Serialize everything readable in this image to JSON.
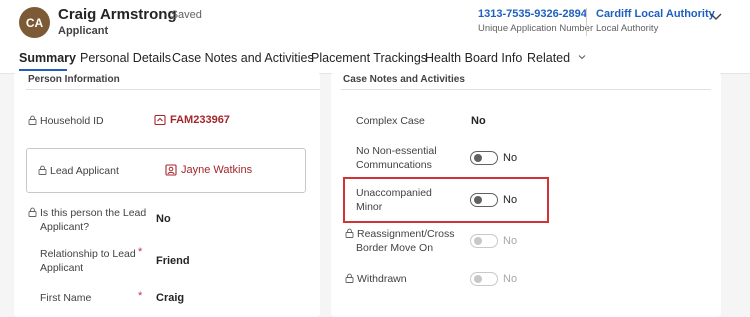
{
  "record": {
    "initials": "CA",
    "name": "Craig Armstrong",
    "saved_status": "- Saved",
    "entity_type": "Applicant"
  },
  "header_fields": [
    {
      "value": "1313-7535-9326-2894",
      "label": "Unique Application Number"
    },
    {
      "value": "Cardiff Local Authority",
      "label": "Local Authority"
    }
  ],
  "tabs": [
    {
      "label": "Summary",
      "active": true
    },
    {
      "label": "Personal Details",
      "active": false
    },
    {
      "label": "Case Notes and Activities",
      "active": false
    },
    {
      "label": "Placement Trackings",
      "active": false
    },
    {
      "label": "Health Board Info",
      "active": false
    },
    {
      "label": "Related",
      "active": false
    }
  ],
  "person_info": {
    "title": "Person Information",
    "household_id": {
      "label": "Household ID",
      "value": "FAM233967"
    },
    "lead_applicant": {
      "label": "Lead Applicant",
      "value": "Jayne Watkins"
    },
    "is_lead": {
      "label_line1": "Is this person the Lead",
      "label_line2": "Applicant?",
      "value": "No"
    },
    "relationship": {
      "label_line1": "Relationship to Lead",
      "label_line2": "Applicant",
      "required": "*",
      "value": "Friend"
    },
    "first_name": {
      "label": "First Name",
      "required": "*",
      "value": "Craig"
    }
  },
  "case_notes": {
    "title": "Case Notes and Activities",
    "complex_case": {
      "label": "Complex Case",
      "value": "No"
    },
    "non_essential": {
      "label_line1": "No Non-essential",
      "label_line2": "Communcations",
      "value": "No"
    },
    "unaccompanied": {
      "label_line1": "Unaccompanied",
      "label_line2": "Minor",
      "value": "No"
    },
    "reassignment": {
      "label_line1": "Reassignment/Cross",
      "label_line2": "Border Move On",
      "value": "No"
    },
    "withdrawn": {
      "label": "Withdrawn",
      "value": "No"
    }
  },
  "colors": {
    "accent": "#1f5fbf",
    "link": "#a4262c",
    "highlight": "#d13438",
    "avatar": "#7d5a36"
  },
  "icons": [
    "lock-icon",
    "household-record-icon",
    "contact-record-icon",
    "chevron-down-icon"
  ]
}
